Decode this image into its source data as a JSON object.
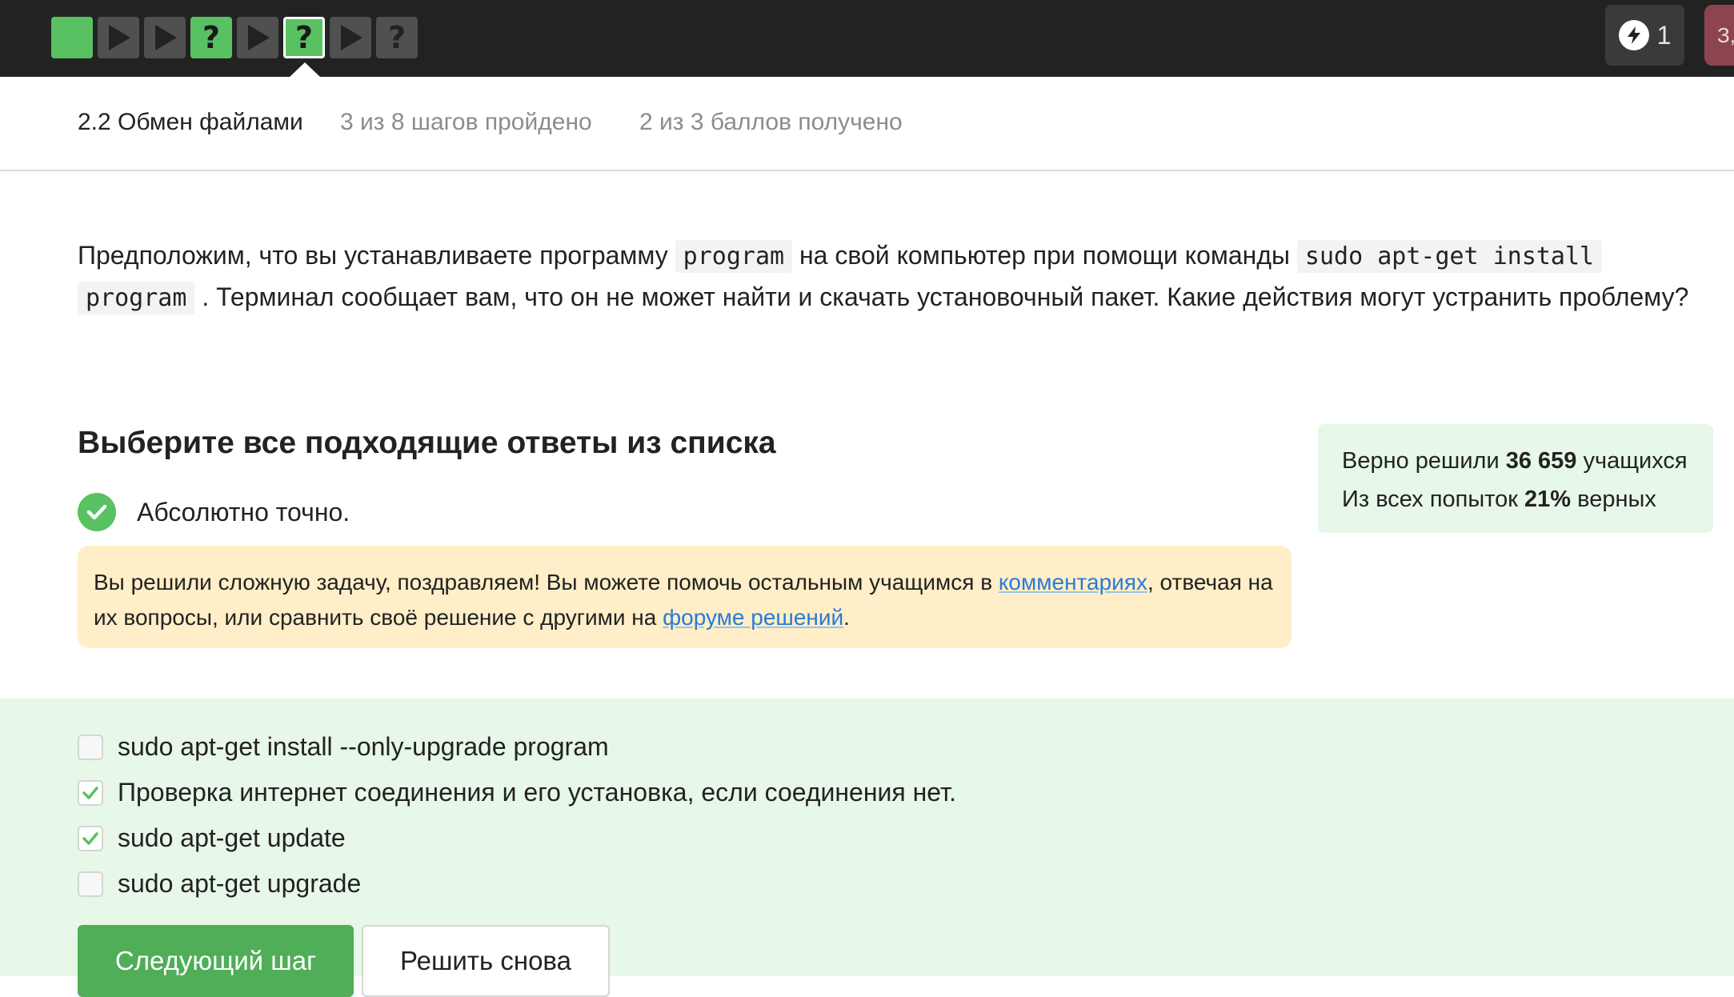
{
  "top_nav": {
    "steps": [
      {
        "type": "text",
        "state": "passed",
        "icon": "text-step"
      },
      {
        "type": "video",
        "state": "default",
        "icon": "play-icon"
      },
      {
        "type": "video",
        "state": "default",
        "icon": "play-icon"
      },
      {
        "type": "quiz",
        "state": "passed",
        "icon": "question-icon"
      },
      {
        "type": "video",
        "state": "default",
        "icon": "play-icon"
      },
      {
        "type": "quiz",
        "state": "passed-active",
        "icon": "question-icon"
      },
      {
        "type": "video",
        "state": "default",
        "icon": "play-icon"
      },
      {
        "type": "quiz",
        "state": "default",
        "icon": "question-icon"
      }
    ],
    "quiz_glyph": "?",
    "energy_count": "1",
    "avatar_label": "З,"
  },
  "lesson": {
    "title": "2.2 Обмен файлами",
    "steps_progress": "3 из 8 шагов пройдено",
    "points_progress": "2 из 3 баллов  получено"
  },
  "question": {
    "p1": "Предположим, что вы устанавливаете программу ",
    "code1": "program",
    "p2": " на свой компьютер при помощи команды ",
    "code2": "sudo apt-get install",
    "code3": "program",
    "p3": " . Терминал сообщает вам, что он не может найти и скачать установочный пакет. Какие действия могут устранить проблему?"
  },
  "instruction": "Выберите все подходящие ответы из списка",
  "stats": {
    "line1_prefix": "Верно решили ",
    "line1_number": "36 659",
    "line1_suffix": " учащихся",
    "line2_prefix": "Из всех попыток ",
    "line2_number": "21%",
    "line2_suffix": " верных"
  },
  "feedback": {
    "text": "Абсолютно точно."
  },
  "hint": {
    "part1": "Вы решили сложную задачу, поздравляем! Вы можете помочь остальным учащимся в ",
    "link1": "комментариях",
    "part2": ", отвечая на их вопросы, или сравнить своё решение с другими на ",
    "link2": "форуме решений",
    "part3": "."
  },
  "options": [
    {
      "label": "sudo apt-get install --only-upgrade program",
      "checked": false
    },
    {
      "label": "Проверка интернет соединения и его установка, если соединения нет.",
      "checked": true
    },
    {
      "label": "sudo apt-get update",
      "checked": true
    },
    {
      "label": "sudo apt-get upgrade",
      "checked": false
    }
  ],
  "buttons": {
    "next": "Следующий шаг",
    "retry": "Решить снова"
  },
  "colors": {
    "topbar": "#222222",
    "step_green": "#59c162",
    "step_grey": "#505050",
    "success_bg": "#e7f7e8",
    "hint_bg": "#ffeec7",
    "link": "#2a7bd6",
    "primary_button": "#4fae57"
  }
}
